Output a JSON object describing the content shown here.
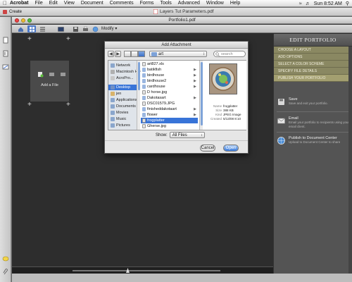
{
  "menubar": {
    "items": [
      "Acrobat",
      "File",
      "Edit",
      "View",
      "Document",
      "Comments",
      "Forms",
      "Tools",
      "Advanced",
      "Window",
      "Help"
    ],
    "clock": "Sun 8:52 AM"
  },
  "background_window": {
    "create_label": "Create",
    "title": "Layers Tut Parameters.pdf"
  },
  "main_window": {
    "title": "Portfolio1.pdf",
    "toolbar": {
      "modify_label": "Modify"
    }
  },
  "workspace": {
    "add_file_label": "Add a File"
  },
  "edit_panel": {
    "title": "EDIT PORTFOLIO",
    "menu": [
      {
        "label": "CHOOSE A LAYOUT",
        "active": false
      },
      {
        "label": "ADD OPTIONS",
        "active": false
      },
      {
        "label": "SELECT A COLOR SCHEME",
        "active": false
      },
      {
        "label": "SPECIFY FILE DETAILS",
        "active": false
      },
      {
        "label": "PUBLISH YOUR PORTFOLIO",
        "active": true
      }
    ],
    "publish_actions": [
      {
        "title": "Save",
        "desc": "Save and exit your portfolio."
      },
      {
        "title": "Email",
        "desc": "Email your portfolio to recipients using your email client."
      },
      {
        "title": "Publish to Document Center",
        "desc": "Upload to Document Center to share"
      }
    ]
  },
  "dialog": {
    "title": "Add Attachment",
    "folder": "art",
    "search_placeholder": "search",
    "sidebar": [
      {
        "label": "Network",
        "color": "#8aa6cc",
        "selected": false
      },
      {
        "label": "Macintosh HD",
        "color": "#b0b0b0",
        "selected": false
      },
      {
        "label": "AcroPro...",
        "color": "#c8c8c8",
        "selected": false
      },
      {
        "label": "Desktop",
        "color": "#6f8fc6",
        "selected": true
      },
      {
        "label": "jen",
        "color": "#d8b36a",
        "selected": false
      },
      {
        "label": "Applications",
        "color": "#8aa6cc",
        "selected": false
      },
      {
        "label": "Documents",
        "color": "#8aa6cc",
        "selected": false
      },
      {
        "label": "Movies",
        "color": "#8aa6cc",
        "selected": false
      },
      {
        "label": "Music",
        "color": "#8aa6cc",
        "selected": false
      },
      {
        "label": "Pictures",
        "color": "#8aa6cc",
        "selected": false
      }
    ],
    "files": [
      {
        "label": "art827.xls",
        "kind": "doc",
        "folder": false,
        "selected": false
      },
      {
        "label": "batikfish",
        "kind": "folder",
        "folder": true,
        "selected": false
      },
      {
        "label": "birdhouse",
        "kind": "folder",
        "folder": true,
        "selected": false
      },
      {
        "label": "birdhouse2",
        "kind": "folder",
        "folder": true,
        "selected": false
      },
      {
        "label": "cardhouse",
        "kind": "folder",
        "folder": true,
        "selected": false
      },
      {
        "label": "D horse.jpg",
        "kind": "doc",
        "folder": false,
        "selected": false
      },
      {
        "label": "Dakotasart",
        "kind": "folder",
        "folder": true,
        "selected": false
      },
      {
        "label": "DSC01579.JPG",
        "kind": "doc",
        "folder": false,
        "selected": false
      },
      {
        "label": "finisheddakotaart",
        "kind": "folder",
        "folder": true,
        "selected": false
      },
      {
        "label": "flower",
        "kind": "folder",
        "folder": true,
        "selected": false
      },
      {
        "label": "frogplatter",
        "kind": "doc",
        "folder": false,
        "selected": true
      },
      {
        "label": "Gherse.jpg",
        "kind": "doc",
        "folder": false,
        "selected": false
      }
    ],
    "preview": {
      "meta": [
        {
          "key": "Name",
          "value": "frogplatter"
        },
        {
          "key": "Size",
          "value": "388 KB"
        },
        {
          "key": "Kind",
          "value": "JPEG Image"
        },
        {
          "key": "Created",
          "value": "5/13/08 8:10"
        }
      ]
    },
    "show_label": "Show:",
    "show_value": "All Files",
    "cancel_label": "Cancel",
    "open_label": "Open"
  }
}
